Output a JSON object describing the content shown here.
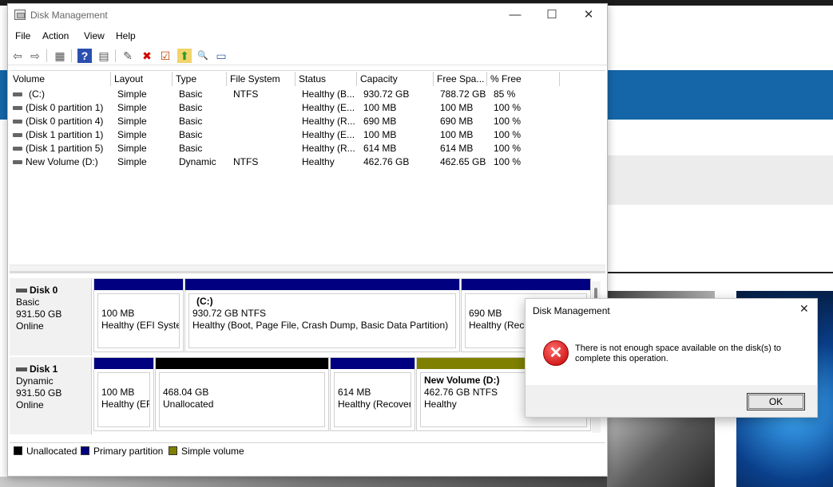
{
  "window": {
    "title": "Disk Management",
    "minimize": "—",
    "maximize": "☐",
    "close": "✕"
  },
  "menu": [
    "File",
    "Action",
    "View",
    "Help"
  ],
  "toolbar": {
    "back": "⇦",
    "forward": "⇨",
    "show_hide": "▦",
    "help": "?",
    "properties": "▤",
    "connect": "✎",
    "delete": "✖",
    "check": "☑",
    "up": "⬆",
    "find": "🔍",
    "view": "▭"
  },
  "volume_list": {
    "headers": [
      "Volume",
      "Layout",
      "Type",
      "File System",
      "Status",
      "Capacity",
      "Free Spa...",
      "% Free"
    ],
    "rows": [
      [
        "(C:)",
        "Simple",
        "Basic",
        "NTFS",
        "Healthy (B...",
        "930.72 GB",
        "788.72 GB",
        "85 %"
      ],
      [
        "(Disk 0 partition 1)",
        "Simple",
        "Basic",
        "",
        "Healthy (E...",
        "100 MB",
        "100 MB",
        "100 %"
      ],
      [
        "(Disk 0 partition 4)",
        "Simple",
        "Basic",
        "",
        "Healthy (R...",
        "690 MB",
        "690 MB",
        "100 %"
      ],
      [
        "(Disk 1 partition 1)",
        "Simple",
        "Basic",
        "",
        "Healthy (E...",
        "100 MB",
        "100 MB",
        "100 %"
      ],
      [
        "(Disk 1 partition 5)",
        "Simple",
        "Basic",
        "",
        "Healthy (R...",
        "614 MB",
        "614 MB",
        "100 %"
      ],
      [
        "New Volume (D:)",
        "Simple",
        "Dynamic",
        "NTFS",
        "Healthy",
        "462.76 GB",
        "462.65 GB",
        "100 %"
      ]
    ]
  },
  "disks": [
    {
      "name": "Disk 0",
      "type": "Basic",
      "size": "931.50 GB",
      "state": "Online",
      "partitions": [
        {
          "title": "",
          "line1": "100 MB",
          "line2": "Healthy (EFI System"
        },
        {
          "title": "(C:)",
          "line1": "930.72 GB NTFS",
          "line2": "Healthy (Boot, Page File, Crash Dump, Basic Data Partition)"
        },
        {
          "title": "",
          "line1": "690 MB",
          "line2": "Healthy (Recovery"
        }
      ]
    },
    {
      "name": "Disk 1",
      "type": "Dynamic",
      "size": "931.50 GB",
      "state": "Online",
      "partitions": [
        {
          "title": "",
          "line1": "100 MB",
          "line2": "Healthy (EF"
        },
        {
          "title": "",
          "line1": "468.04 GB",
          "line2": "Unallocated"
        },
        {
          "title": "",
          "line1": "614 MB",
          "line2": "Healthy (Recover"
        },
        {
          "title": "New Volume  (D:)",
          "line1": "462.76 GB NTFS",
          "line2": "Healthy"
        }
      ]
    }
  ],
  "legend": [
    {
      "label": "Unallocated",
      "color": "#000000"
    },
    {
      "label": "Primary partition",
      "color": "#000080"
    },
    {
      "label": "Simple volume",
      "color": "#808000"
    }
  ],
  "dialog": {
    "title": "Disk Management",
    "close": "✕",
    "message": "There is not enough space available on the disk(s) to complete this operation.",
    "icon": "✕",
    "ok": "OK"
  }
}
